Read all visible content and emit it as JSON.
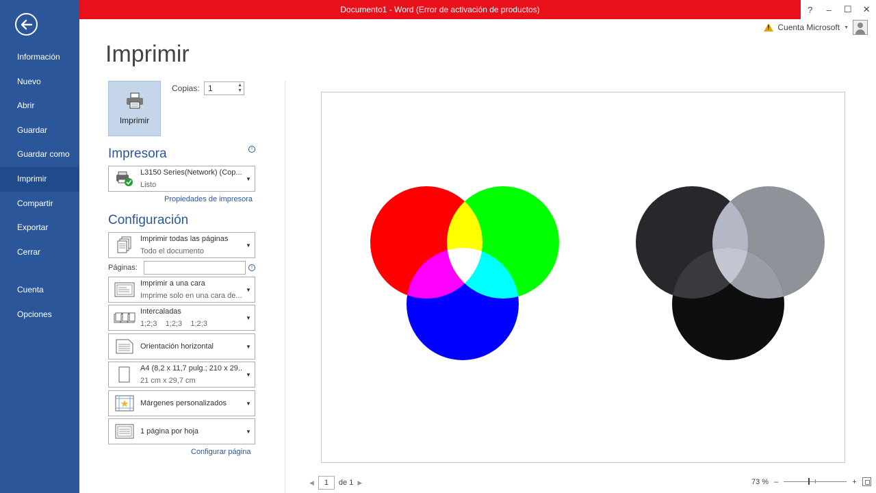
{
  "window": {
    "title": "Documento1 -  Word (Error de activación de productos)",
    "controls": [
      "?",
      "–",
      "☐",
      "✕"
    ],
    "accent_color": "#e8101a"
  },
  "account": {
    "label": "Cuenta Microsoft",
    "warning_icon": "warning-icon"
  },
  "sidebar": {
    "color": "#2b579a",
    "back_icon": "back-arrow-icon",
    "items": [
      {
        "label": "Información"
      },
      {
        "label": "Nuevo"
      },
      {
        "label": "Abrir"
      },
      {
        "label": "Guardar"
      },
      {
        "label": "Guardar como"
      },
      {
        "label": "Imprimir",
        "active": true
      },
      {
        "label": "Compartir"
      },
      {
        "label": "Exportar"
      },
      {
        "label": "Cerrar"
      },
      {
        "label": "Cuenta"
      },
      {
        "label": "Opciones"
      }
    ]
  },
  "print": {
    "title": "Imprimir",
    "print_button_label": "Imprimir",
    "copies_label": "Copias:",
    "copies_value": "1"
  },
  "printer": {
    "heading": "Impresora",
    "name": "L3150 Series(Network) (Cop...",
    "status": "Listo",
    "properties_link": "Propiedades de impresora"
  },
  "settings": {
    "heading": "Configuración",
    "pages_label": "Páginas:",
    "pages_value": "",
    "options": [
      {
        "title": "Imprimir todas las páginas",
        "subtitle": "Todo el documento",
        "icon": "pages-icon"
      },
      {
        "title": "Imprimir a una cara",
        "subtitle": "Imprime solo en una cara de...",
        "icon": "one-sided-icon"
      },
      {
        "title": "Intercaladas",
        "subtitle": "1;2;3    1;2;3    1;2;3",
        "icon": "collated-icon"
      },
      {
        "title": "Orientación horizontal",
        "subtitle": "",
        "icon": "orientation-icon"
      },
      {
        "title": "A4 (8,2 x 11,7 pulg.; 210 x 29...",
        "subtitle": "21 cm x 29,7 cm",
        "icon": "paper-size-icon"
      },
      {
        "title": "Márgenes personalizados",
        "subtitle": "",
        "icon": "margins-icon"
      },
      {
        "title": "1 página por hoja",
        "subtitle": "",
        "icon": "pages-per-sheet-icon"
      }
    ],
    "page_setup_link": "Configurar página"
  },
  "preview": {
    "page_number": "1",
    "page_of": "de 1",
    "zoom": "73 %",
    "zoom_minus": "–",
    "zoom_plus": "+",
    "circle_colors_rgb": [
      "#ff0000",
      "#00ff00",
      "#0000ff"
    ],
    "circle_colors_gray": [
      "#28282c",
      "#8e9299",
      "#0e0e10"
    ]
  }
}
